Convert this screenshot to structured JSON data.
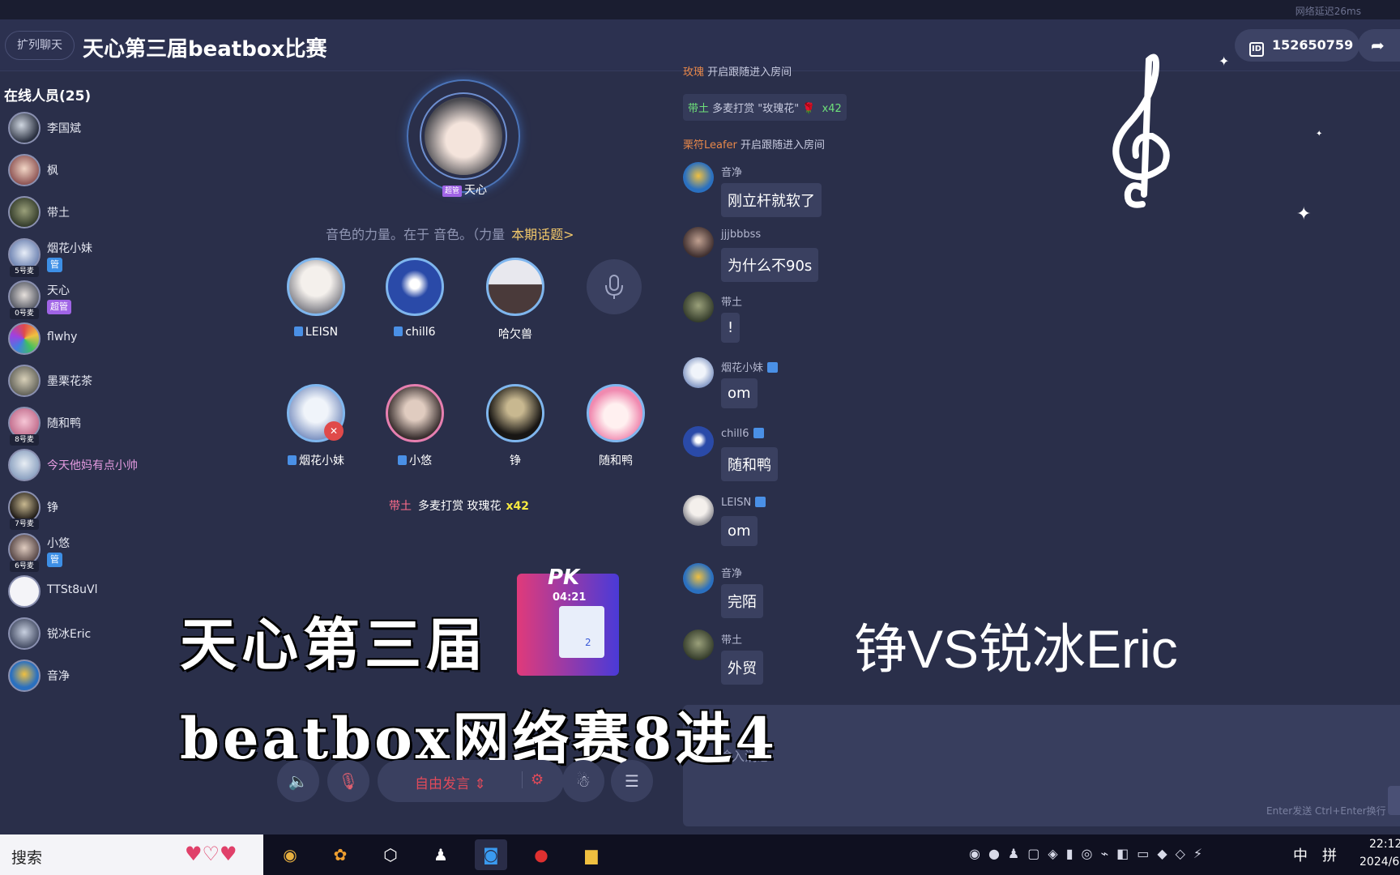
{
  "header": {
    "latency": "网络延迟26ms",
    "expand_label": "扩列聊天",
    "title": "天心第三届beatbox比赛",
    "room_id": "152650759",
    "share_label": "邀"
  },
  "members": {
    "title": "在线人员(25)",
    "items": [
      {
        "name": "李国斌"
      },
      {
        "name": "枫"
      },
      {
        "name": "带土"
      },
      {
        "name": "烟花小妹",
        "seat": "5号麦",
        "badge": "管"
      },
      {
        "name": "天心",
        "seat": "0号麦",
        "badge": "超管"
      },
      {
        "name": "flwhy"
      },
      {
        "name": "墨栗花茶"
      },
      {
        "name": "随和鸭",
        "seat": "8号麦"
      },
      {
        "name": "今天他妈有点小帅"
      },
      {
        "name": "铮",
        "seat": "7号麦"
      },
      {
        "name": "小悠",
        "seat": "6号麦",
        "badge": "管"
      },
      {
        "name": "TTSt8uVl"
      },
      {
        "name": "锐冰Eric"
      },
      {
        "name": "音净"
      }
    ]
  },
  "stage": {
    "host_tag": "超管",
    "host_name": "天心",
    "topic": "音色的力量。在于 音色。（力量",
    "topic_link": "本期话题>",
    "seats_row1": [
      {
        "name": "LEISN"
      },
      {
        "name": "chill6"
      },
      {
        "name": "哈欠兽"
      }
    ],
    "seats_row2": [
      {
        "name": "烟花小妹"
      },
      {
        "name": "小悠"
      },
      {
        "name": "铮"
      },
      {
        "name": "随和鸭"
      }
    ],
    "gift": {
      "user": "带土",
      "text": "多麦打赏  玫瑰花",
      "count": "x42"
    },
    "pk": {
      "label": "PK",
      "time": "04:21",
      "count": "2"
    }
  },
  "controls": {
    "free_speak": "自由发言 ⇕"
  },
  "chat": {
    "sys1": {
      "user": "玫瑰",
      "text": "开启跟随进入房间"
    },
    "gift": {
      "user": "带土",
      "text": "多麦打赏 \"玫瑰花\"",
      "count": "x42"
    },
    "sys2": {
      "user": "栗符Leafer",
      "text": "开启跟随进入房间"
    },
    "messages": [
      {
        "name": "音净",
        "text": "刚立杆就软了"
      },
      {
        "name": "jjjbbbss",
        "text": "为什么不90s"
      },
      {
        "name": "带土",
        "text": "!"
      },
      {
        "name": "烟花小妹",
        "text": "om"
      },
      {
        "name": "chill6",
        "text": "随和鸭"
      },
      {
        "name": "LEISN",
        "text": "om"
      },
      {
        "name": "音净",
        "text": "完陌"
      },
      {
        "name": "带土",
        "text": "外贸"
      }
    ],
    "input_placeholder": "输入消息",
    "input_hint": "Enter发送 Ctrl+Enter换行"
  },
  "overlay": {
    "line1": "天心第三届",
    "line2": "beatbox网络赛8进4",
    "vs": "铮VS锐冰Eric"
  },
  "taskbar": {
    "search": "搜索",
    "lang": "中",
    "ime": "拼",
    "time": "22:12",
    "date": "2024/6"
  }
}
